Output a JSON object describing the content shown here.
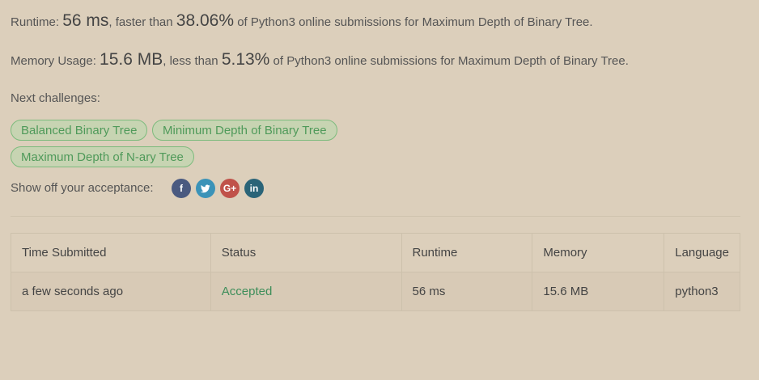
{
  "runtime": {
    "label": "Runtime:",
    "value": "56 ms",
    "comparison": ", faster than",
    "percent": "38.06%",
    "suffix": "of Python3 online submissions for Maximum Depth of Binary Tree."
  },
  "memory": {
    "label": "Memory Usage:",
    "value": "15.6 MB",
    "comparison": ", less than",
    "percent": "5.13%",
    "suffix": "of Python3 online submissions for Maximum Depth of Binary Tree."
  },
  "next_challenges": {
    "label": "Next challenges:",
    "items": [
      {
        "label": "Balanced Binary Tree"
      },
      {
        "label": "Minimum Depth of Binary Tree"
      },
      {
        "label": "Maximum Depth of N-ary Tree"
      }
    ]
  },
  "share": {
    "label": "Show off your acceptance:",
    "icons": [
      {
        "name": "facebook-icon",
        "glyph": "f",
        "color": "#4a5a80"
      },
      {
        "name": "twitter-icon",
        "glyph": "t",
        "color": "#3b93b8"
      },
      {
        "name": "google-plus-icon",
        "glyph": "G+",
        "color": "#c0524a"
      },
      {
        "name": "linkedin-icon",
        "glyph": "in",
        "color": "#2a6478"
      }
    ]
  },
  "table": {
    "headers": [
      "Time Submitted",
      "Status",
      "Runtime",
      "Memory",
      "Language"
    ],
    "rows": [
      [
        "a few seconds ago",
        "Accepted",
        "56 ms",
        "15.6 MB",
        "python3"
      ]
    ]
  },
  "colors": {
    "background": "#dccfbb",
    "accepted": "#3e8e5a",
    "chip_border": "#7dbb7d",
    "chip_text": "#4f9a5a"
  }
}
